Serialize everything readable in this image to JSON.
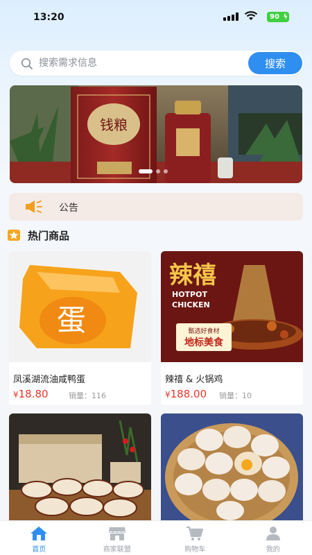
{
  "status_bar": {
    "time": "13:20",
    "battery": "90"
  },
  "search": {
    "placeholder": "搜索需求信息",
    "button_label": "搜索"
  },
  "notice": {
    "label": "公告"
  },
  "section": {
    "title": "热门商品"
  },
  "products": [
    {
      "name": "凤溪湖流油咸鸭蛋",
      "currency": "¥",
      "price": "18.80",
      "sales_label": "销量：",
      "sales": "116"
    },
    {
      "name": "辣禧 & 火锅鸡",
      "currency": "¥",
      "price": "188.00",
      "sales_label": "销量：",
      "sales": "10"
    },
    {
      "name": "",
      "currency": "",
      "price": "",
      "sales_label": "",
      "sales": ""
    },
    {
      "name": "",
      "currency": "",
      "price": "",
      "sales_label": "",
      "sales": ""
    }
  ],
  "product_images": {
    "duck_egg_char": "蛋",
    "hotpot_title": "辣禧",
    "hotpot_en1": "HOTPOT",
    "hotpot_en2": "CHICKEN",
    "hotpot_tag1": "甄选好食材",
    "hotpot_tag2": "地标美食",
    "banner_label": "钱粮"
  },
  "tabs": [
    {
      "label": "首页",
      "icon": "home-icon",
      "active": true
    },
    {
      "label": "商家联盟",
      "icon": "store-icon",
      "active": false
    },
    {
      "label": "购物车",
      "icon": "cart-icon",
      "active": false
    },
    {
      "label": "我的",
      "icon": "user-icon",
      "active": false
    }
  ],
  "colors": {
    "accent": "#2f8ff0",
    "price": "#e8362b",
    "notice_bg": "#f5ebe6",
    "star": "#f6a623"
  }
}
